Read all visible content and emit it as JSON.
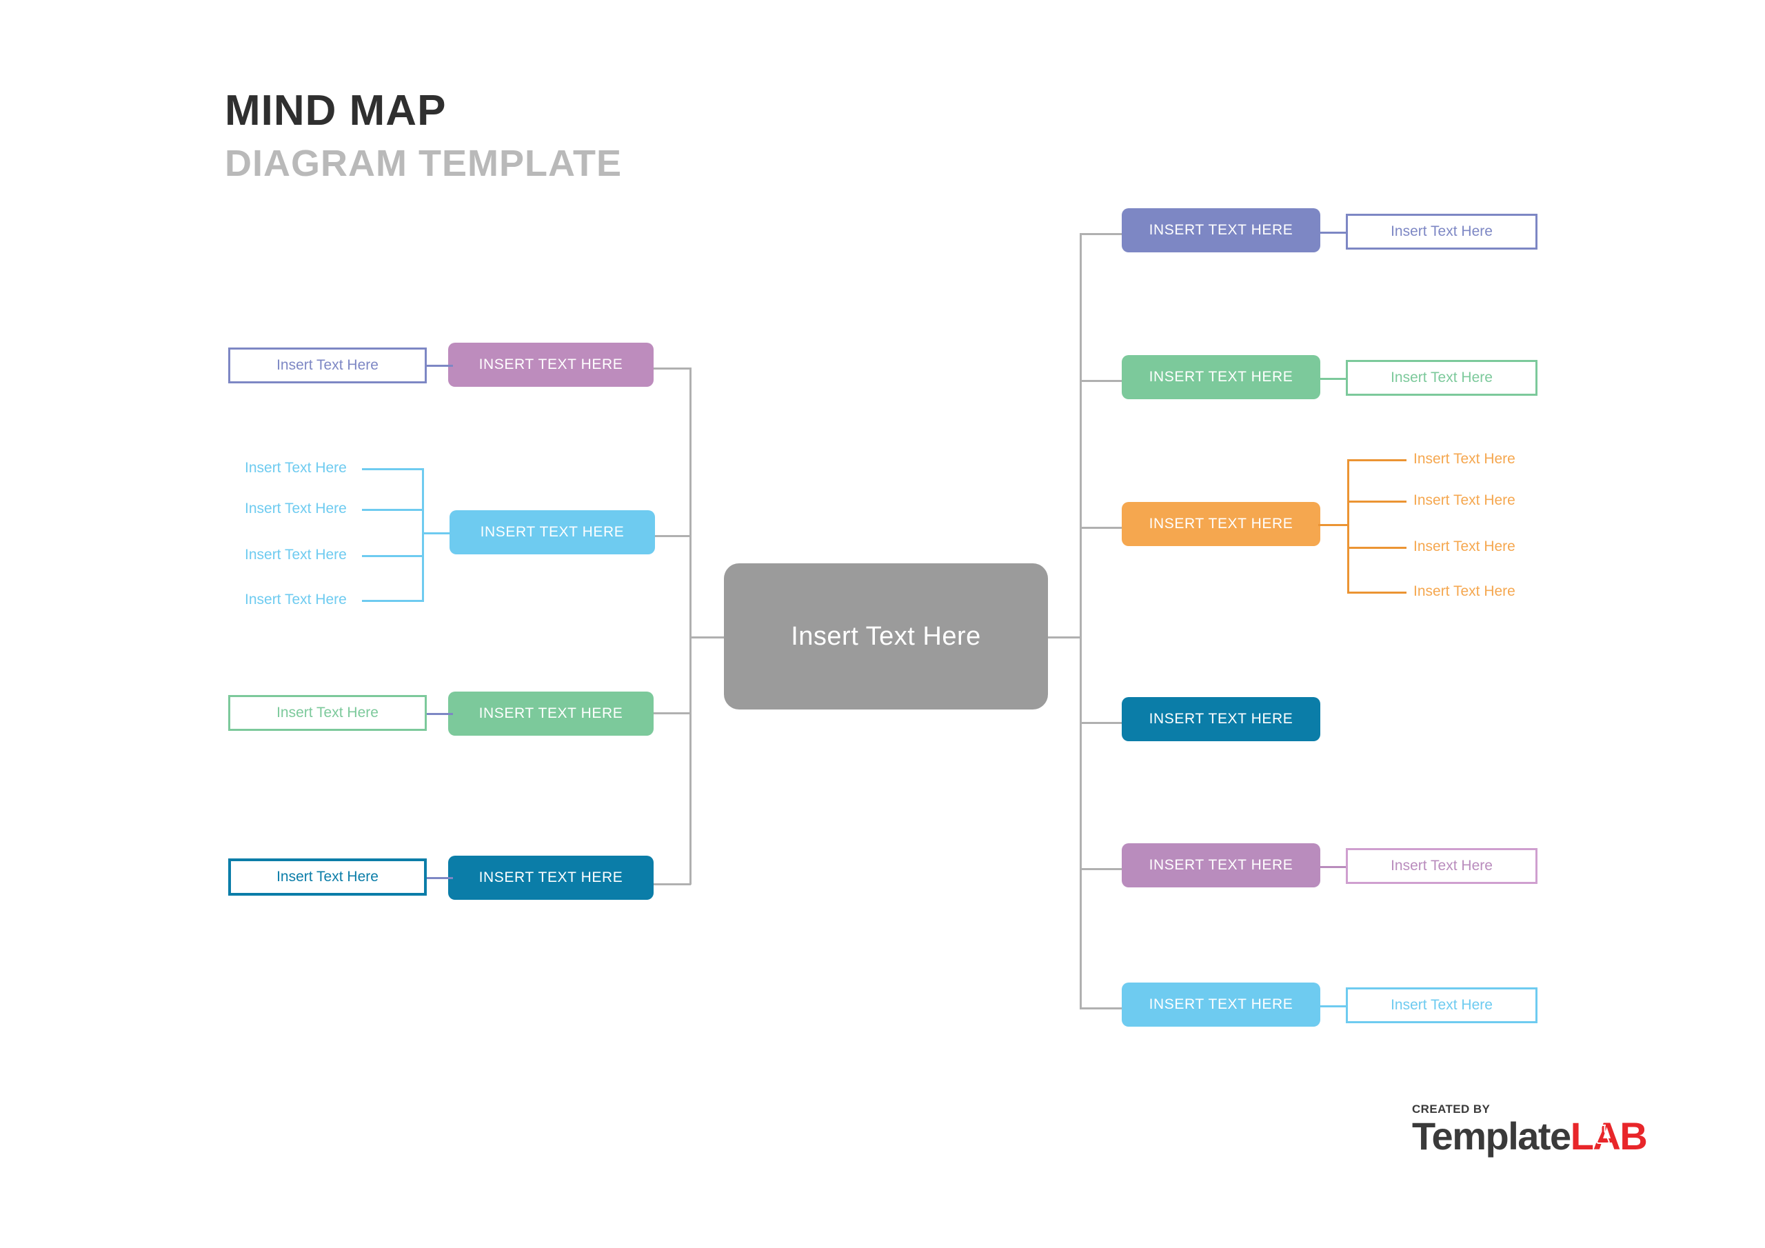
{
  "title": {
    "line1": "MIND MAP",
    "line2": "DIAGRAM TEMPLATE"
  },
  "center": {
    "label": "Insert Text Here",
    "color": "#9b9b9b"
  },
  "palette": {
    "purple": "#bd8cbd",
    "sky": "#6ecbf0",
    "green": "#7cc99b",
    "teal": "#0b7da8",
    "periwinkle": "#7d87c4",
    "orange": "#f5a council",
    "orange_fix": "#f5a busy"
  },
  "colors": {
    "purple": "#bd8cbd",
    "sky": "#6ecbf0",
    "green": "#7cc99b",
    "teal": "#0b7da8",
    "periwinkle": "#7d87c4",
    "orange": "#f5a74f",
    "mauve": "#b98cbd",
    "cyan": "#6ecbf0",
    "trunk_gray": "#b0b0b0",
    "title_dark": "#2f2f2f",
    "title_gray": "#b9b9b9",
    "logo_red": "#e8262a",
    "logo_dark": "#3a3a3a"
  },
  "left_branches": [
    {
      "id": "purple",
      "node_label": "INSERT TEXT HERE",
      "color": "#bd8cbd",
      "child_type": "box",
      "children": [
        {
          "label": "Insert Text Here"
        }
      ]
    },
    {
      "id": "sky",
      "node_label": "INSERT TEXT HERE",
      "color": "#6ecbf0",
      "child_type": "labels",
      "children": [
        {
          "label": "Insert Text Here"
        },
        {
          "label": "Insert Text Here"
        },
        {
          "label": "Insert Text Here"
        },
        {
          "label": "Insert Text Here"
        }
      ]
    },
    {
      "id": "green",
      "node_label": "INSERT TEXT HERE",
      "color": "#7cc99b",
      "child_type": "box",
      "children": [
        {
          "label": "Insert Text Here"
        }
      ]
    },
    {
      "id": "teal",
      "node_label": "INSERT TEXT HERE",
      "color": "#0b7da8",
      "child_type": "box",
      "children": [
        {
          "label": "Insert Text Here"
        }
      ]
    }
  ],
  "right_branches": [
    {
      "id": "periwinkle",
      "node_label": "INSERT TEXT HERE",
      "color": "#7d87c4",
      "child_type": "box",
      "children": [
        {
          "label": "Insert Text Here"
        }
      ]
    },
    {
      "id": "green",
      "node_label": "INSERT TEXT HERE",
      "color": "#7cc99b",
      "child_type": "box",
      "children": [
        {
          "label": "Insert Text Here"
        }
      ]
    },
    {
      "id": "orange",
      "node_label": "INSERT TEXT HERE",
      "color": "#f5a74f",
      "child_type": "labels",
      "children": [
        {
          "label": "Insert Text Here"
        },
        {
          "label": "Insert Text Here"
        },
        {
          "label": "Insert Text Here"
        },
        {
          "label": "Insert Text Here"
        }
      ]
    },
    {
      "id": "teal",
      "node_label": "INSERT TEXT HERE",
      "color": "#0b7da8",
      "child_type": "none",
      "children": []
    },
    {
      "id": "mauve",
      "node_label": "INSERT TEXT HERE",
      "color": "#b98cbd",
      "child_type": "box",
      "children": [
        {
          "label": "Insert Text Here"
        }
      ]
    },
    {
      "id": "cyan",
      "node_label": "INSERT TEXT HERE",
      "color": "#6ecbf0",
      "child_type": "box",
      "children": [
        {
          "label": "Insert Text Here"
        }
      ]
    }
  ],
  "logo": {
    "created_by": "CREATED BY",
    "word_dark": "Template",
    "word_red": "LAB"
  }
}
